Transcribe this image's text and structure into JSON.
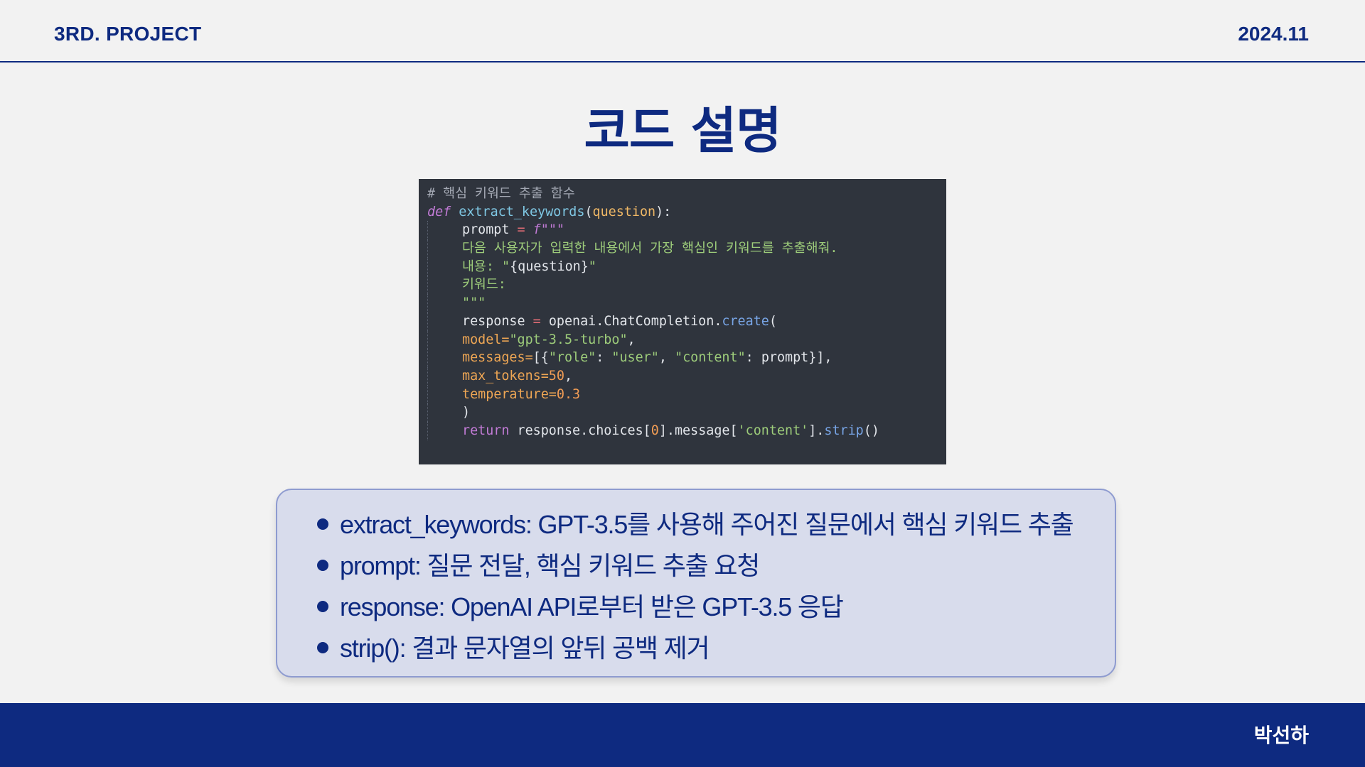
{
  "header": {
    "project": "3RD. PROJECT",
    "date": "2024.11"
  },
  "title": "코드 설명",
  "code": {
    "comment": "# 핵심 키워드 추출 함수",
    "def_kw": "def",
    "fn_name": "extract_keywords",
    "param": "question",
    "prompt_var": "prompt",
    "prompt_open": "f\"\"\"",
    "prompt_line1": "다음 사용자가 입력한 내용에서 가장 핵심인 키워드를 추출해줘.",
    "prompt_line2a": "내용: \"",
    "prompt_line2b": "{question}",
    "prompt_line2c": "\"",
    "prompt_line3": "키워드:",
    "prompt_close": "\"\"\"",
    "response_var": "response",
    "openai_call": "openai.ChatCompletion",
    "create": "create",
    "model_arg": "model=",
    "model_val": "\"gpt-3.5-turbo\"",
    "messages_arg": "messages=",
    "messages_open": "[{",
    "role_key": "\"role\"",
    "role_val": "\"user\"",
    "content_key": "\"content\"",
    "messages_close": "prompt}],",
    "max_tokens_arg": "max_tokens=",
    "max_tokens_val": "50",
    "temperature_arg": "temperature=",
    "temperature_val": "0.3",
    "close_paren": ")",
    "return_kw": "return",
    "return_a": " response.choices[",
    "return_idx": "0",
    "return_b": "].message[",
    "return_key": "'content'",
    "return_c": "].",
    "strip": "strip",
    "return_d": "()"
  },
  "bullets": [
    "extract_keywords: GPT-3.5를 사용해 주어진 질문에서 핵심 키워드 추출",
    "prompt: 질문 전달, 핵심 키워드 추출 요청",
    "response: OpenAI API로부터 받은 GPT-3.5 응답",
    "strip(): 결과 문자열의 앞뒤 공백 제거"
  ],
  "footer": {
    "author": "박선하"
  },
  "colors": {
    "brand": "#0e2a80",
    "code_bg": "#2f343d",
    "box_bg": "#d8dcec"
  }
}
